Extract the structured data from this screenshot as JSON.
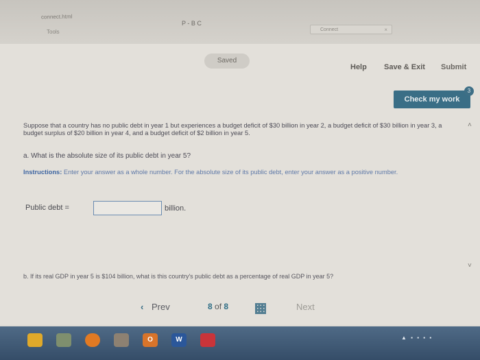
{
  "browser": {
    "url": "connect.html",
    "tools_label": "Tools",
    "address_icons": "P - B C",
    "tab_title": "Connect",
    "tab_close": "×"
  },
  "header": {
    "saved_label": "Saved",
    "help_label": "Help",
    "save_exit_label": "Save & Exit",
    "submit_label": "Submit",
    "check_label": "Check my work",
    "check_badge": "3"
  },
  "question": {
    "text": "Suppose that a country has no public debt in year 1 but experiences a budget deficit of $30 billion in year 2, a budget deficit of $30 billion in year 3, a budget surplus of $20 billion in year 4, and a budget deficit of $2 billion in year 5.",
    "part_a": "a. What is the absolute size of its public debt in year 5?",
    "instructions_label": "Instructions:",
    "instructions_text": "Enter your answer as a whole number. For the absolute size of its public debt, enter your answer as a positive number.",
    "answer_label": "Public debt =",
    "answer_value": "",
    "answer_unit": "billion.",
    "part_b": "b. If its real GDP in year 5 is $104 billion, what is this country's public debt as a percentage of real GDP in year 5?"
  },
  "navigation": {
    "prev_label": "Prev",
    "current_page": "8",
    "of_label": "of",
    "total_pages": "8",
    "next_label": "Next"
  },
  "taskbar": {
    "apps": [
      {
        "name": "chrome",
        "color": "#e0a92a"
      },
      {
        "name": "windows-explorer",
        "color": "#7f8f6e"
      },
      {
        "name": "firefox",
        "color": "#e27a23"
      },
      {
        "name": "media",
        "color": "#8d8172"
      },
      {
        "name": "outlook",
        "color": "#d8742a",
        "label": "O"
      },
      {
        "name": "word",
        "color": "#2b579a",
        "label": "W"
      },
      {
        "name": "app-red",
        "color": "#c9343a"
      }
    ],
    "tray": "▲ ▪ ▪ ▪ ▪"
  }
}
